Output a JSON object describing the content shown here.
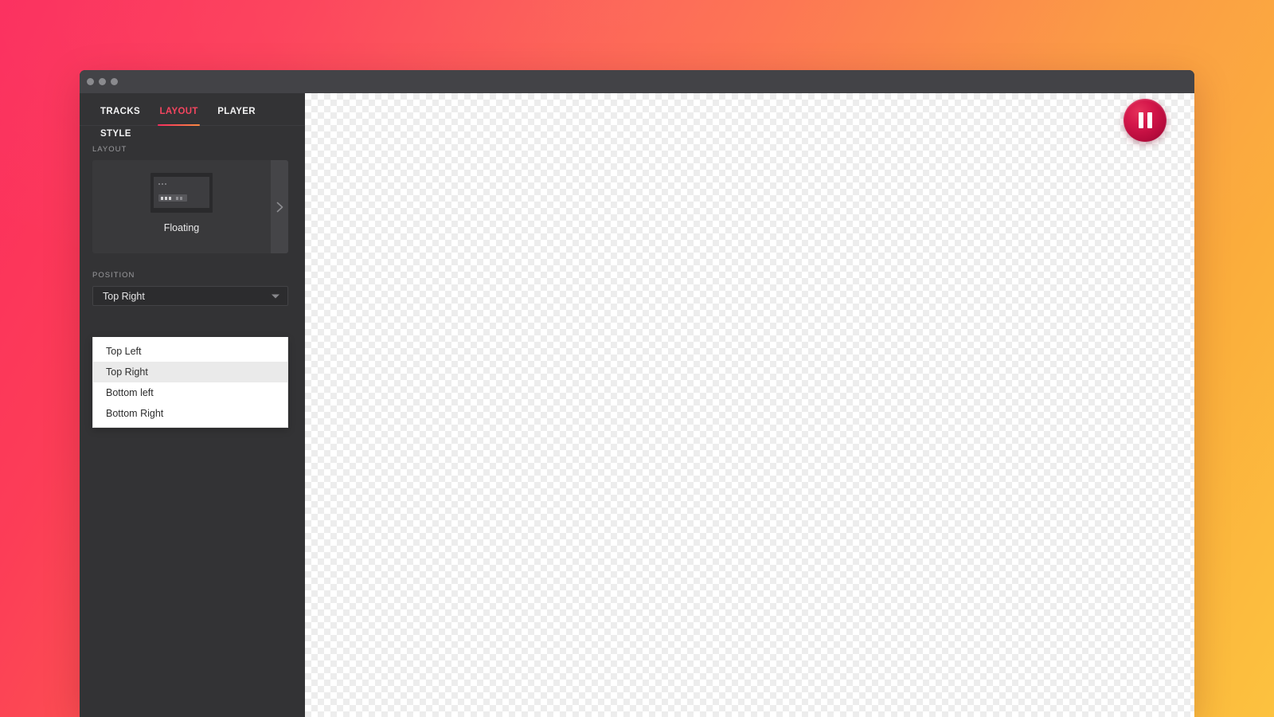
{
  "background": {
    "gradient_from": "#FB2E5E",
    "gradient_to": "#FCC23F"
  },
  "window": {
    "titlebar": {
      "dots": [
        "window-close-dot",
        "window-minimize-dot",
        "window-zoom-dot"
      ],
      "dot_color": "#8a8a8e"
    }
  },
  "sidebar": {
    "tabs": [
      {
        "label": "TRACKS",
        "active": false
      },
      {
        "label": "LAYOUT",
        "active": true
      },
      {
        "label": "PLAYER",
        "active": false
      },
      {
        "label": "STYLE",
        "active": false
      }
    ],
    "active_tab_color": "#F4455F",
    "layout_section": {
      "label": "LAYOUT",
      "selected_layout": "Floating",
      "next_icon": "chevron-right-icon"
    },
    "position_section": {
      "label": "POSITION",
      "select": {
        "value": "Top Right",
        "caret_icon": "caret-down-icon",
        "open": true,
        "options": [
          {
            "label": "Top Left",
            "selected": false
          },
          {
            "label": "Top Right",
            "selected": true
          },
          {
            "label": "Bottom left",
            "selected": false
          },
          {
            "label": "Bottom Right",
            "selected": false
          }
        ]
      }
    }
  },
  "canvas": {
    "transparency_checker": true,
    "floating_player": {
      "icon": "pause-icon",
      "position": "Top Right",
      "color": "#C4103F"
    }
  }
}
